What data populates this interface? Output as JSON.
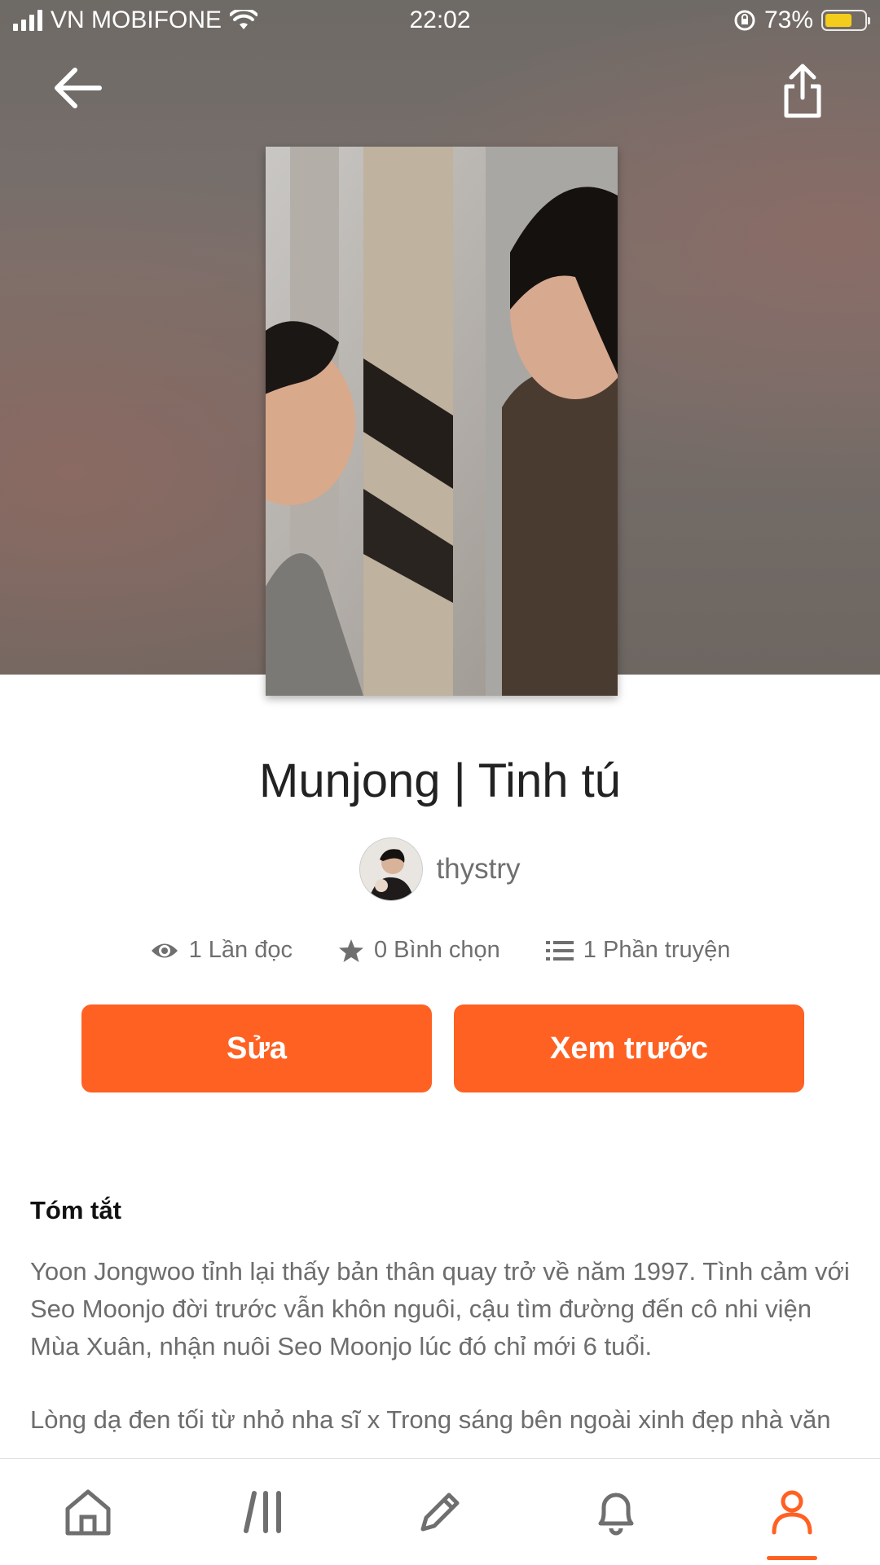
{
  "status_bar": {
    "carrier": "VN MOBIFONE",
    "time": "22:02",
    "battery_percent_label": "73%",
    "battery_level": 0.73
  },
  "story": {
    "title": "Munjong | Tinh tú",
    "author": "thystry"
  },
  "stats": {
    "reads": "1 Lần đọc",
    "votes": "0 Bình chọn",
    "parts": "1 Phần truyện"
  },
  "actions": {
    "edit_label": "Sửa",
    "preview_label": "Xem trước"
  },
  "summary": {
    "heading": "Tóm tắt",
    "paragraph1": "Yoon Jongwoo tỉnh lại thấy bản thân quay trở về năm 1997. Tình cảm với Seo Moonjo đời trước vẫn khôn nguôi, cậu tìm đường đến cô nhi viện Mùa Xuân, nhận nuôi Seo Moonjo lúc đó chỉ mới 6 tuổi.",
    "paragraph2": "Lòng dạ đen tối từ nhỏ nha sĩ x Trong sáng bên ngoài xinh đẹp nhà văn"
  },
  "tabbar": {
    "items": [
      "home-icon",
      "library-icon",
      "write-icon",
      "notifications-icon",
      "profile-icon"
    ],
    "active": "profile-icon",
    "accent": "#ff6122"
  },
  "colors": {
    "accent": "#ff6122",
    "battery": "#f4cc1b"
  }
}
